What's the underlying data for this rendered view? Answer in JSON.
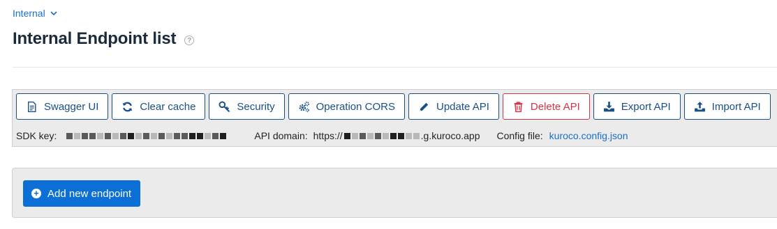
{
  "breadcrumb": {
    "label": "Internal"
  },
  "page": {
    "title": "Internal Endpoint list",
    "help_glyph": "?"
  },
  "toolbar": {
    "swagger_label": "Swagger UI",
    "clear_cache_label": "Clear cache",
    "security_label": "Security",
    "cors_label": "Operation CORS",
    "update_label": "Update API",
    "delete_label": "Delete API",
    "export_label": "Export API",
    "import_label": "Import API"
  },
  "info": {
    "sdk_key_label": "SDK key:",
    "api_domain_label": "API domain:",
    "api_domain_prefix": "https://",
    "api_domain_suffix": ".g.kuroco.app",
    "config_file_label": "Config file:",
    "config_file_value": "kuroco.config.json"
  },
  "actions": {
    "add_endpoint_label": "Add new endpoint",
    "add_glyph": "+"
  },
  "colors": {
    "accent": "#0c6fd6",
    "outline": "#1a4f86",
    "danger": "#d0364a",
    "link": "#1a6fc9"
  }
}
